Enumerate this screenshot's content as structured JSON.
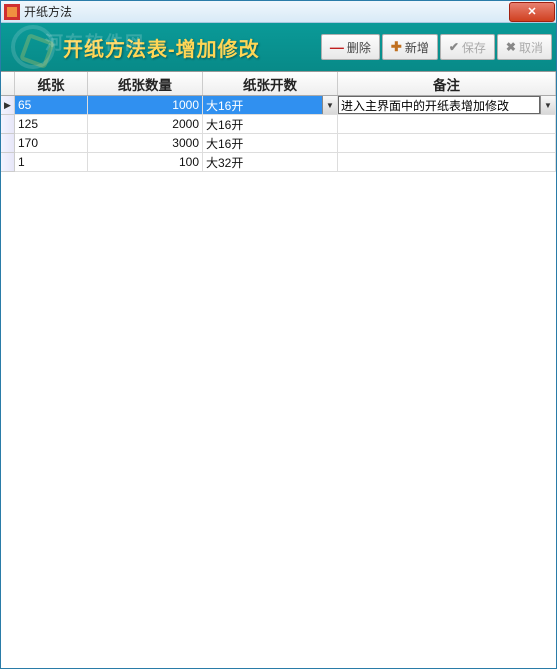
{
  "window": {
    "title": "开纸方法"
  },
  "header": {
    "title": "开纸方法表-增加修改",
    "watermark": "河东软件网"
  },
  "toolbar": {
    "delete_label": "删除",
    "add_label": "新增",
    "save_label": "保存",
    "cancel_label": "取消"
  },
  "grid": {
    "columns": {
      "paper": "纸张",
      "qty": "纸张数量",
      "cuts": "纸张开数",
      "remark": "备注"
    },
    "rows": [
      {
        "paper": "65",
        "qty": "1000",
        "cuts": "大16开",
        "remark": "进入主界面中的开纸表增加修改",
        "selected": true
      },
      {
        "paper": "125",
        "qty": "2000",
        "cuts": "大16开",
        "remark": ""
      },
      {
        "paper": "170",
        "qty": "3000",
        "cuts": "大16开",
        "remark": ""
      },
      {
        "paper": "1",
        "qty": "100",
        "cuts": "大32开",
        "remark": ""
      }
    ]
  }
}
